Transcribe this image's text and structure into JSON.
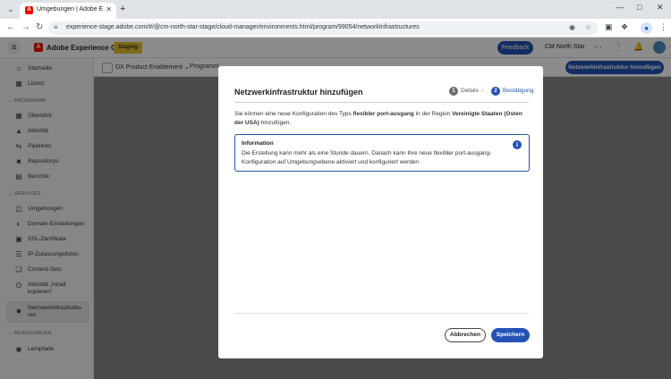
{
  "browser": {
    "tab_title": "Umgebungen | Adobe Experience",
    "url": "experience-stage.adobe.com/#/@cm-north-star-stage/cloud-manager/environments.html/program/99054/networkInfrastructures"
  },
  "header": {
    "brand": "Adobe Experience Cloud",
    "badge": "Staging",
    "feedback_label": "Feedback",
    "org_name": "CM North Star"
  },
  "sidebar": {
    "top_items": [
      {
        "label": "Startseite",
        "icon": "home-icon"
      },
      {
        "label": "Lizenz",
        "icon": "license-icon"
      }
    ],
    "sections": [
      {
        "title": "PROGRAMM",
        "items": [
          {
            "label": "Überblick",
            "icon": "overview-icon"
          },
          {
            "label": "Aktivität",
            "icon": "bell-icon"
          },
          {
            "label": "Pipelines",
            "icon": "pipeline-icon"
          },
          {
            "label": "Repositorys",
            "icon": "folder-icon"
          },
          {
            "label": "Berichte",
            "icon": "report-icon"
          }
        ]
      },
      {
        "title": "SERVICES",
        "items": [
          {
            "label": "Umgebungen",
            "icon": "environments-icon"
          },
          {
            "label": "Domain-Einstellungen",
            "icon": "globe-icon"
          },
          {
            "label": "SSL-Zertifikate",
            "icon": "lock-icon"
          },
          {
            "label": "IP-Zulassungslisten",
            "icon": "list-icon"
          },
          {
            "label": "Content-Sets",
            "icon": "box-icon"
          },
          {
            "label": "Aktivität „Inhalt kopieren“",
            "icon": "history-icon"
          },
          {
            "label": "Netzwerkinfrastruktu-ren",
            "icon": "network-icon"
          }
        ]
      },
      {
        "title": "RESSOURCEN",
        "items": [
          {
            "label": "Lernpfade",
            "icon": "learn-icon"
          }
        ]
      }
    ]
  },
  "content_header": {
    "program": "DX Product Enablement",
    "breadcrumb_partial": "Programm",
    "add_button": "Netzwerkinfrastruktur hinzufügen"
  },
  "dialog": {
    "title": "Netzwerkinfrastruktur hinzufügen",
    "steps": [
      {
        "number": "1",
        "label": "Details",
        "state": "complete"
      },
      {
        "number": "2",
        "label": "Bestätigung",
        "state": "current"
      }
    ],
    "description_prefix": "Sie können eine neue Konfiguration des Typs ",
    "description_type": "flexibler port-ausgang",
    "description_middle": " in der Region ",
    "description_region": "Vereinigte Staaten (Osten der USA)",
    "description_suffix": " hinzufügen.",
    "info_title": "Information",
    "info_text": "Die Erstellung kann mehr als eine Stunde dauern. Danach kann Ihre neue flexibler port-ausgang-Konfiguration auf Umgebungsebene aktiviert und konfiguriert werden",
    "cancel_label": "Abbrechen",
    "save_label": "Speichern"
  },
  "colors": {
    "accent": "#2253b5",
    "adobe_red": "#eb1000",
    "staging_badge": "#e6c02f"
  }
}
